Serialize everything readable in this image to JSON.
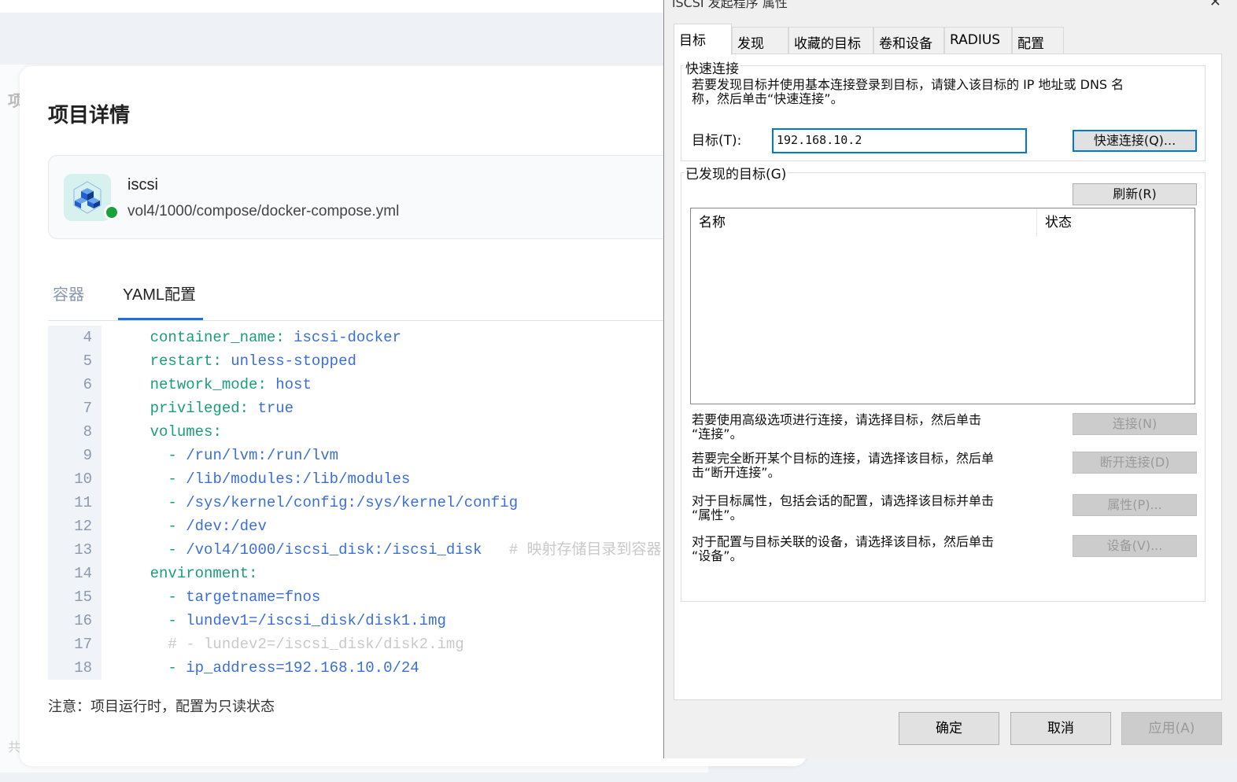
{
  "page": {
    "bg_fragment_top": "项",
    "bg_fragment_bottom": "共"
  },
  "project": {
    "title": "项目详情",
    "name": "iscsi",
    "path": "vol4/1000/compose/docker-compose.yml",
    "status_color": "#15a33a"
  },
  "tabs": [
    {
      "label": "容器"
    },
    {
      "label": "YAML配置"
    }
  ],
  "code": [
    {
      "n": "4",
      "indent": "    ",
      "key": "container_name",
      "sep": ": ",
      "value": "iscsi-docker",
      "comment": ""
    },
    {
      "n": "5",
      "indent": "    ",
      "key": "restart",
      "sep": ": ",
      "value": "unless-stopped",
      "comment": ""
    },
    {
      "n": "6",
      "indent": "    ",
      "key": "network_mode",
      "sep": ": ",
      "value": "host",
      "comment": ""
    },
    {
      "n": "7",
      "indent": "    ",
      "key": "privileged",
      "sep": ": ",
      "value": "true",
      "comment": ""
    },
    {
      "n": "8",
      "indent": "    ",
      "key": "volumes",
      "sep": ":",
      "value": "",
      "comment": ""
    },
    {
      "n": "9",
      "indent": "      ",
      "key": "",
      "sep": "- ",
      "value": "/run/lvm:/run/lvm",
      "comment": ""
    },
    {
      "n": "10",
      "indent": "      ",
      "key": "",
      "sep": "- ",
      "value": "/lib/modules:/lib/modules",
      "comment": ""
    },
    {
      "n": "11",
      "indent": "      ",
      "key": "",
      "sep": "- ",
      "value": "/sys/kernel/config:/sys/kernel/config",
      "comment": ""
    },
    {
      "n": "12",
      "indent": "      ",
      "key": "",
      "sep": "- ",
      "value": "/dev:/dev",
      "comment": ""
    },
    {
      "n": "13",
      "indent": "      ",
      "key": "",
      "sep": "- ",
      "value": "/vol4/1000/iscsi_disk:/iscsi_disk",
      "comment": "   # 映射存储目录到容器"
    },
    {
      "n": "14",
      "indent": "    ",
      "key": "environment",
      "sep": ":",
      "value": "",
      "comment": ""
    },
    {
      "n": "15",
      "indent": "      ",
      "key": "",
      "sep": "- ",
      "value": "targetname=fnos",
      "comment": ""
    },
    {
      "n": "16",
      "indent": "      ",
      "key": "",
      "sep": "- ",
      "value": "lundev1=/iscsi_disk/disk1.img",
      "comment": ""
    },
    {
      "n": "17",
      "indent": "      ",
      "key": "",
      "sep": "",
      "value": "",
      "comment": "# - lundev2=/iscsi_disk/disk2.img"
    },
    {
      "n": "18",
      "indent": "      ",
      "key": "",
      "sep": "- ",
      "value": "ip_address=192.168.10.0/24",
      "comment": ""
    }
  ],
  "note": "注意：项目运行时，配置为只读状态",
  "dialog": {
    "title": "iSCSI 发起程序 属性",
    "close": "✕",
    "tabs": [
      "目标",
      "发现",
      "收藏的目标",
      "卷和设备",
      "RADIUS",
      "配置"
    ],
    "quick": {
      "label": "快速连接",
      "desc1": "若要发现目标并使用基本连接登录到目标，请键入该目标的 IP 地址或 DNS 名",
      "desc2": "称，然后单击“快速连接”。",
      "target_label": "目标(T):",
      "target_value": "192.168.10.2",
      "button": "快速连接(Q)..."
    },
    "discovered": {
      "label": "已发现的目标(G)",
      "refresh": "刷新(R)",
      "columns": [
        "名称",
        "状态"
      ]
    },
    "actions": [
      {
        "l1": "若要使用高级选项进行连接，请选择目标，然后单击",
        "l2": "“连接”。",
        "button": "连接(N)"
      },
      {
        "l1": "若要完全断开某个目标的连接，请选择该目标，然后单",
        "l2": "击“断开连接”。",
        "button": "断开连接(D)"
      },
      {
        "l1": "对于目标属性，包括会话的配置，请选择该目标并单击",
        "l2": "“属性”。",
        "button": "属性(P)..."
      },
      {
        "l1": "对于配置与目标关联的设备，请选择该目标，然后单击",
        "l2": "“设备”。",
        "button": "设备(V)..."
      }
    ],
    "ok": "确定",
    "cancel": "取消",
    "apply": "应用(A)"
  }
}
